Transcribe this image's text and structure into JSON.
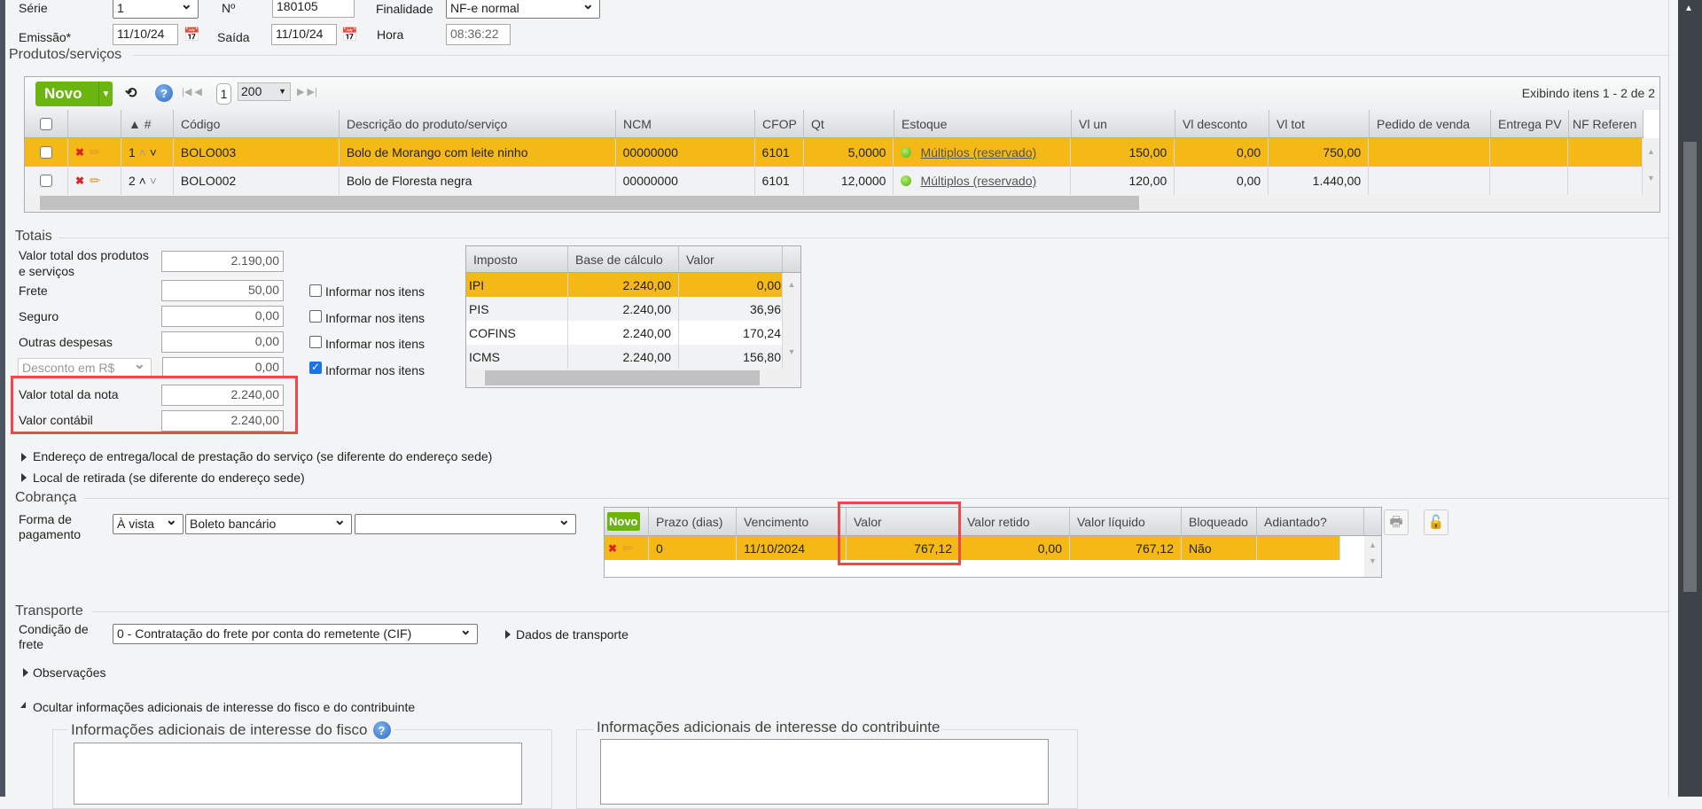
{
  "header": {
    "serie_label": "Série",
    "serie_value": "1",
    "numero_label": "Nº",
    "numero_value": "180105",
    "finalidade_label": "Finalidade",
    "finalidade_value": "NF-e normal",
    "emissao_label": "Emissão*",
    "emissao_value": "11/10/24",
    "saida_label": "Saída",
    "saida_value": "11/10/24",
    "hora_label": "Hora",
    "hora_value": "08:36:22"
  },
  "produtos": {
    "legend": "Produtos/serviços",
    "novo_label": "Novo",
    "page": "1",
    "page_size": "200",
    "status": "Exibindo itens 1 - 2 de 2",
    "columns": [
      "#",
      "Código",
      "Descrição do produto/serviço",
      "NCM",
      "CFOP",
      "Qt",
      "Estoque",
      "Vl un",
      "Vl desconto",
      "Vl tot",
      "Pedido de venda",
      "Entrega PV",
      "NF Referen"
    ],
    "rows": [
      {
        "n": "1",
        "codigo": "BOLO003",
        "descricao": "Bolo de Morango com leite ninho",
        "ncm": "00000000",
        "cfop": "6101",
        "qt": "5,0000",
        "estoque": "Múltiplos (reservado)",
        "vl_un": "150,00",
        "vl_desc": "0,00",
        "vl_tot": "750,00"
      },
      {
        "n": "2",
        "codigo": "BOLO002",
        "descricao": "Bolo de Floresta negra",
        "ncm": "00000000",
        "cfop": "6101",
        "qt": "12,0000",
        "estoque": "Múltiplos (reservado)",
        "vl_un": "120,00",
        "vl_desc": "0,00",
        "vl_tot": "1.440,00"
      }
    ]
  },
  "totais": {
    "legend": "Totais",
    "valor_produtos_label": "Valor total dos produtos e serviços",
    "valor_produtos": "2.190,00",
    "frete_label": "Frete",
    "frete": "50,00",
    "seguro_label": "Seguro",
    "seguro": "0,00",
    "outras_label": "Outras despesas",
    "outras": "0,00",
    "desconto_select": "Desconto em R$",
    "desconto": "0,00",
    "valor_nota_label": "Valor total da nota",
    "valor_nota": "2.240,00",
    "valor_contabil_label": "Valor contábil",
    "valor_contabil": "2.240,00",
    "informar_label": "Informar nos itens",
    "informar_checked": [
      false,
      false,
      false,
      true
    ]
  },
  "impostos": {
    "columns": [
      "Imposto",
      "Base de cálculo",
      "Valor"
    ],
    "rows": [
      {
        "imposto": "IPI",
        "base": "2.240,00",
        "valor": "0,00"
      },
      {
        "imposto": "PIS",
        "base": "2.240,00",
        "valor": "36,96"
      },
      {
        "imposto": "COFINS",
        "base": "2.240,00",
        "valor": "170,24"
      },
      {
        "imposto": "ICMS",
        "base": "2.240,00",
        "valor": "156,80"
      }
    ]
  },
  "sections": {
    "endereco_entrega": "Endereço de entrega/local de prestação do serviço (se diferente do endereço sede)",
    "local_retirada": "Local de retirada (se diferente do endereço sede)"
  },
  "cobranca": {
    "legend": "Cobrança",
    "forma_label": "Forma de pagamento",
    "condicao": "À vista",
    "meio": "Boleto bancário",
    "extra": "",
    "novo_label": "Novo",
    "columns": [
      "Prazo (dias)",
      "Vencimento",
      "Valor",
      "Valor retido",
      "Valor líquido",
      "Bloqueado",
      "Adiantado?"
    ],
    "rows": [
      {
        "prazo": "0",
        "vencimento": "11/10/2024",
        "valor": "767,12",
        "retido": "0,00",
        "liquido": "767,12",
        "bloqueado": "Não",
        "adiantado": ""
      }
    ]
  },
  "transporte": {
    "legend": "Transporte",
    "condicao_label": "Condição de frete",
    "condicao_value": "0 - Contratação do frete por conta do remetente (CIF)",
    "dados_label": "Dados de transporte",
    "observacoes": "Observações",
    "ocultar": "Ocultar informações adicionais de interesse do fisco e do contribuinte",
    "fisco_legend": "Informações adicionais de interesse do fisco",
    "contribuinte_legend": "Informações adicionais de interesse do contribuinte",
    "fisco_value": "",
    "contribuinte_value": ""
  },
  "colors": {
    "highlight": "#f4b916",
    "novo": "#6ab50f",
    "red_box": "#f04848"
  }
}
